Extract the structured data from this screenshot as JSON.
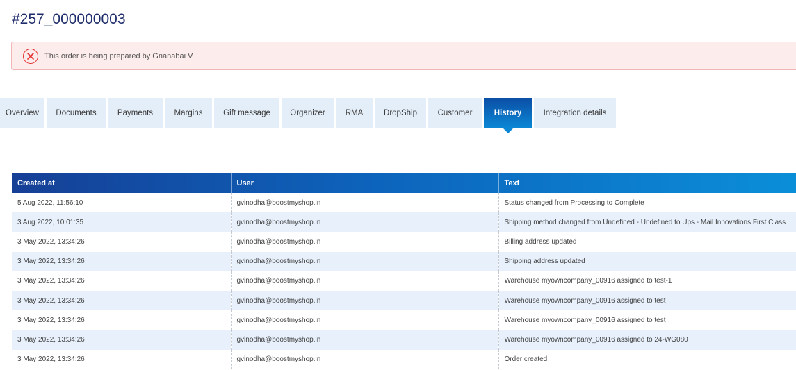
{
  "order": {
    "title": "#257_000000003"
  },
  "alert": {
    "icon": "close-circle-icon",
    "message": "This order is being prepared by Gnanabai V",
    "color": "#e2312f"
  },
  "tabs": [
    {
      "label": "Overview",
      "active": false
    },
    {
      "label": "Documents",
      "active": false
    },
    {
      "label": "Payments",
      "active": false
    },
    {
      "label": "Margins",
      "active": false
    },
    {
      "label": "Gift message",
      "active": false
    },
    {
      "label": "Organizer",
      "active": false
    },
    {
      "label": "RMA",
      "active": false
    },
    {
      "label": "DropShip",
      "active": false
    },
    {
      "label": "Customer",
      "active": false
    },
    {
      "label": "History",
      "active": true
    },
    {
      "label": "Integration details",
      "active": false
    }
  ],
  "history": {
    "columns": [
      "Created at",
      "User",
      "Text"
    ],
    "rows": [
      {
        "created_at": "5 Aug 2022, 11:56:10",
        "user": "gvinodha@boostmyshop.in",
        "text": "Status changed from Processing to Complete"
      },
      {
        "created_at": "3 Aug 2022, 10:01:35",
        "user": "gvinodha@boostmyshop.in",
        "text": "Shipping method changed from Undefined - Undefined to Ups - Mail Innovations First Class"
      },
      {
        "created_at": "3 May 2022, 13:34:26",
        "user": "gvinodha@boostmyshop.in",
        "text": "Billing address updated"
      },
      {
        "created_at": "3 May 2022, 13:34:26",
        "user": "gvinodha@boostmyshop.in",
        "text": "Shipping address updated"
      },
      {
        "created_at": "3 May 2022, 13:34:26",
        "user": "gvinodha@boostmyshop.in",
        "text": "Warehouse myowncompany_00916 assigned to test-1"
      },
      {
        "created_at": "3 May 2022, 13:34:26",
        "user": "gvinodha@boostmyshop.in",
        "text": "Warehouse myowncompany_00916 assigned to test"
      },
      {
        "created_at": "3 May 2022, 13:34:26",
        "user": "gvinodha@boostmyshop.in",
        "text": "Warehouse myowncompany_00916 assigned to test"
      },
      {
        "created_at": "3 May 2022, 13:34:26",
        "user": "gvinodha@boostmyshop.in",
        "text": "Warehouse myowncompany_00916 assigned to 24-WG080"
      },
      {
        "created_at": "3 May 2022, 13:34:26",
        "user": "gvinodha@boostmyshop.in",
        "text": "Order created"
      }
    ]
  }
}
